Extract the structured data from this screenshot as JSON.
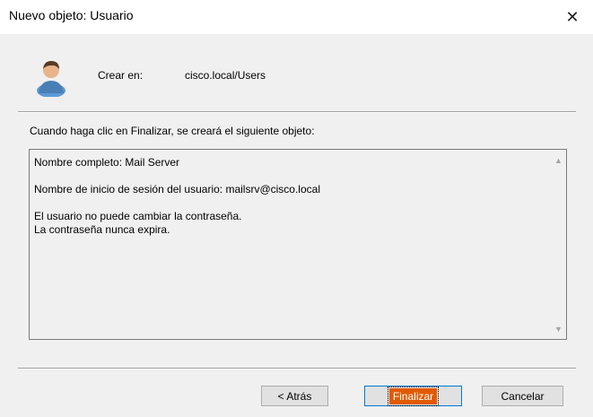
{
  "window": {
    "title": "Nuevo objeto: Usuario",
    "close_glyph": "✕"
  },
  "header": {
    "icon": "user-icon",
    "create_in_label": "Crear en:",
    "create_in_value": "cisco.local/Users"
  },
  "main": {
    "info_text": "Cuando haga clic en Finalizar, se creará el siguiente objeto:",
    "summary_lines": [
      "Nombre completo: Mail Server",
      "Nombre de inicio de sesión del usuario: mailsrv@cisco.local",
      "El usuario no puede cambiar la contraseña.",
      "La contraseña nunca expira."
    ]
  },
  "buttons": {
    "back_label": "< Atrás",
    "finish_label": "Finalizar",
    "cancel_label": "Cancelar"
  },
  "colors": {
    "finish_highlight": "#e25a00",
    "focus_border": "#0078d7"
  }
}
